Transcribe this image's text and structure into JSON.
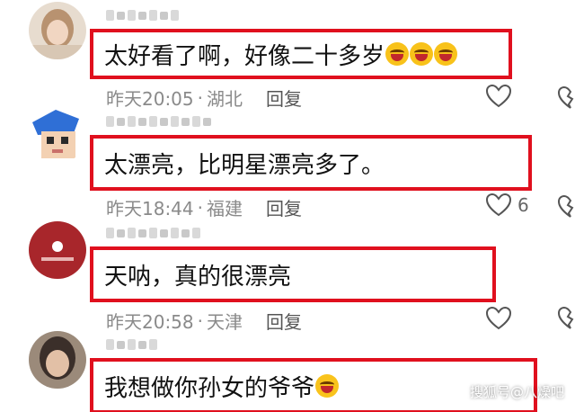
{
  "comments": [
    {
      "text": "太好看了啊，好像二十多岁",
      "emoji": [
        "grinning-squint-emoji",
        "grinning-squint-emoji",
        "grinning-squint-emoji"
      ],
      "time": "昨天20:05",
      "location": "湖北",
      "reply_label": "回复",
      "likes": ""
    },
    {
      "text": "太漂亮，比明星漂亮多了。",
      "emoji": [],
      "time": "昨天18:44",
      "location": "福建",
      "reply_label": "回复",
      "likes": "6"
    },
    {
      "text": "天呐，真的很漂亮",
      "emoji": [],
      "time": "昨天20:58",
      "location": "天津",
      "reply_label": "回复",
      "likes": ""
    },
    {
      "text": "我想做你孙女的爷爷",
      "emoji": [
        "rolling-laughing-emoji"
      ],
      "time": "",
      "location": "",
      "reply_label": "",
      "likes": ""
    }
  ],
  "separator": "·",
  "watermark": "搜狐号@八燥吧",
  "colors": {
    "highlight_border": "#e0101e",
    "meta_text": "#8a8a8a"
  }
}
